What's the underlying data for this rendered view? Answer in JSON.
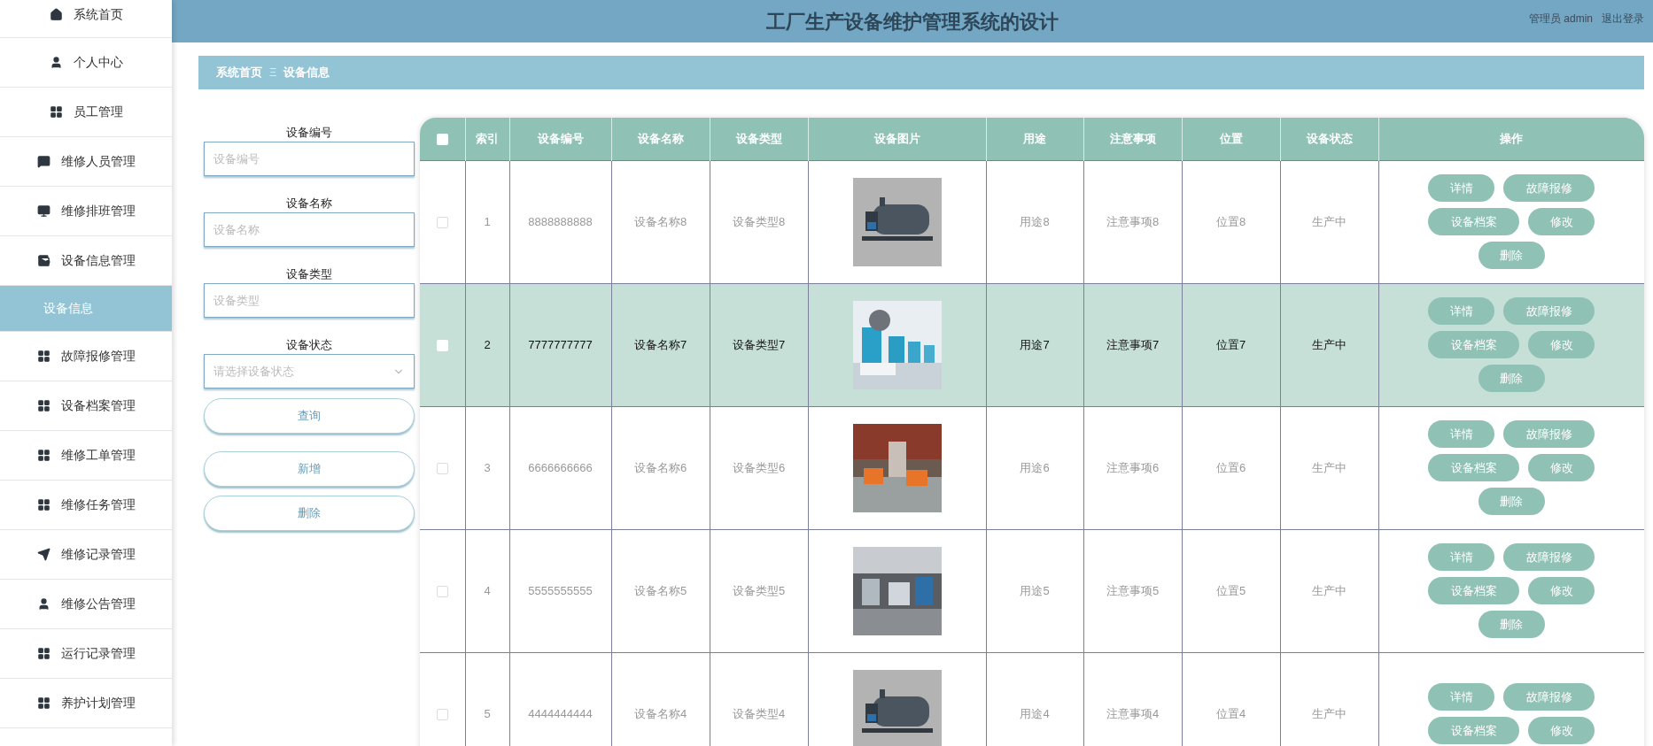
{
  "header": {
    "title": "工厂生产设备维护管理系统的设计",
    "user": "管理员 admin",
    "logout": "退出登录"
  },
  "sidebar": {
    "items": [
      {
        "label": "系统首页",
        "selected": false
      },
      {
        "label": "个人中心",
        "selected": false
      },
      {
        "label": "员工管理",
        "selected": false
      },
      {
        "label": "维修人员管理",
        "selected": false
      },
      {
        "label": "维修排班管理",
        "selected": false
      },
      {
        "label": "设备信息管理",
        "selected": false
      },
      {
        "label": "设备信息",
        "selected": true
      },
      {
        "label": "故障报修管理",
        "selected": false
      },
      {
        "label": "设备档案管理",
        "selected": false
      },
      {
        "label": "维修工单管理",
        "selected": false
      },
      {
        "label": "维修任务管理",
        "selected": false
      },
      {
        "label": "维修记录管理",
        "selected": false
      },
      {
        "label": "维修公告管理",
        "selected": false
      },
      {
        "label": "运行记录管理",
        "selected": false
      },
      {
        "label": "养护计划管理",
        "selected": false
      }
    ]
  },
  "breadcrumb": {
    "home": "系统首页",
    "separator": "Ξ",
    "current": "设备信息"
  },
  "search": {
    "fields": [
      {
        "label": "设备编号",
        "placeholder": "设备编号",
        "kind": "input"
      },
      {
        "label": "设备名称",
        "placeholder": "设备名称",
        "kind": "input"
      },
      {
        "label": "设备类型",
        "placeholder": "设备类型",
        "kind": "input"
      },
      {
        "label": "设备状态",
        "placeholder": "请选择设备状态",
        "kind": "select"
      }
    ],
    "buttons": [
      "查询",
      "新增",
      "删除"
    ]
  },
  "table": {
    "all_checked": false,
    "columns": [
      "索引",
      "设备编号",
      "设备名称",
      "设备类型",
      "设备图片",
      "用途",
      "注意事项",
      "位置",
      "设备状态",
      "操作"
    ],
    "rows": [
      {
        "selected": false,
        "checked": false,
        "cells": [
          {
            "kind": "text",
            "text": "1"
          },
          {
            "kind": "text",
            "text": "8888888888"
          },
          {
            "kind": "text",
            "text": "设备名称8"
          },
          {
            "kind": "text",
            "text": "设备类型8"
          },
          {
            "kind": "picture"
          },
          {
            "kind": "text",
            "text": "用途8"
          },
          {
            "kind": "text",
            "text": "注意事项8"
          },
          {
            "kind": "text",
            "text": "位置8"
          },
          {
            "kind": "text",
            "text": "生产中"
          },
          {
            "kind": "actions",
            "actions": [
              "详情",
              "故障报修",
              "设备档案",
              "修改",
              "删除"
            ]
          }
        ]
      },
      {
        "selected": true,
        "checked": false,
        "cells": [
          {
            "kind": "text",
            "text": "2"
          },
          {
            "kind": "text",
            "text": "7777777777"
          },
          {
            "kind": "text",
            "text": "设备名称7"
          },
          {
            "kind": "text",
            "text": "设备类型7"
          },
          {
            "kind": "picture"
          },
          {
            "kind": "text",
            "text": "用途7"
          },
          {
            "kind": "text",
            "text": "注意事项7"
          },
          {
            "kind": "text",
            "text": "位置7"
          },
          {
            "kind": "text",
            "text": "生产中"
          },
          {
            "kind": "actions",
            "actions": [
              "详情",
              "故障报修",
              "设备档案",
              "修改",
              "删除"
            ]
          }
        ]
      },
      {
        "selected": false,
        "checked": false,
        "cells": [
          {
            "kind": "text",
            "text": "3"
          },
          {
            "kind": "text",
            "text": "6666666666"
          },
          {
            "kind": "text",
            "text": "设备名称6"
          },
          {
            "kind": "text",
            "text": "设备类型6"
          },
          {
            "kind": "picture"
          },
          {
            "kind": "text",
            "text": "用途6"
          },
          {
            "kind": "text",
            "text": "注意事项6"
          },
          {
            "kind": "text",
            "text": "位置6"
          },
          {
            "kind": "text",
            "text": "生产中"
          },
          {
            "kind": "actions",
            "actions": [
              "详情",
              "故障报修",
              "设备档案",
              "修改",
              "删除"
            ]
          }
        ]
      },
      {
        "selected": false,
        "checked": false,
        "cells": [
          {
            "kind": "text",
            "text": "4"
          },
          {
            "kind": "text",
            "text": "5555555555"
          },
          {
            "kind": "text",
            "text": "设备名称5"
          },
          {
            "kind": "text",
            "text": "设备类型5"
          },
          {
            "kind": "picture"
          },
          {
            "kind": "text",
            "text": "用途5"
          },
          {
            "kind": "text",
            "text": "注意事项5"
          },
          {
            "kind": "text",
            "text": "位置5"
          },
          {
            "kind": "text",
            "text": "生产中"
          },
          {
            "kind": "actions",
            "actions": [
              "详情",
              "故障报修",
              "设备档案",
              "修改",
              "删除"
            ]
          }
        ]
      },
      {
        "selected": false,
        "checked": false,
        "cells": [
          {
            "kind": "text",
            "text": "5"
          },
          {
            "kind": "text",
            "text": "4444444444"
          },
          {
            "kind": "text",
            "text": "设备名称4"
          },
          {
            "kind": "text",
            "text": "设备类型4"
          },
          {
            "kind": "picture"
          },
          {
            "kind": "text",
            "text": "用途4"
          },
          {
            "kind": "text",
            "text": "注意事项4"
          },
          {
            "kind": "text",
            "text": "位置4"
          },
          {
            "kind": "text",
            "text": "生产中"
          },
          {
            "kind": "actions",
            "actions": [
              "详情",
              "故障报修",
              "设备档案",
              "修改"
            ]
          }
        ]
      }
    ]
  }
}
